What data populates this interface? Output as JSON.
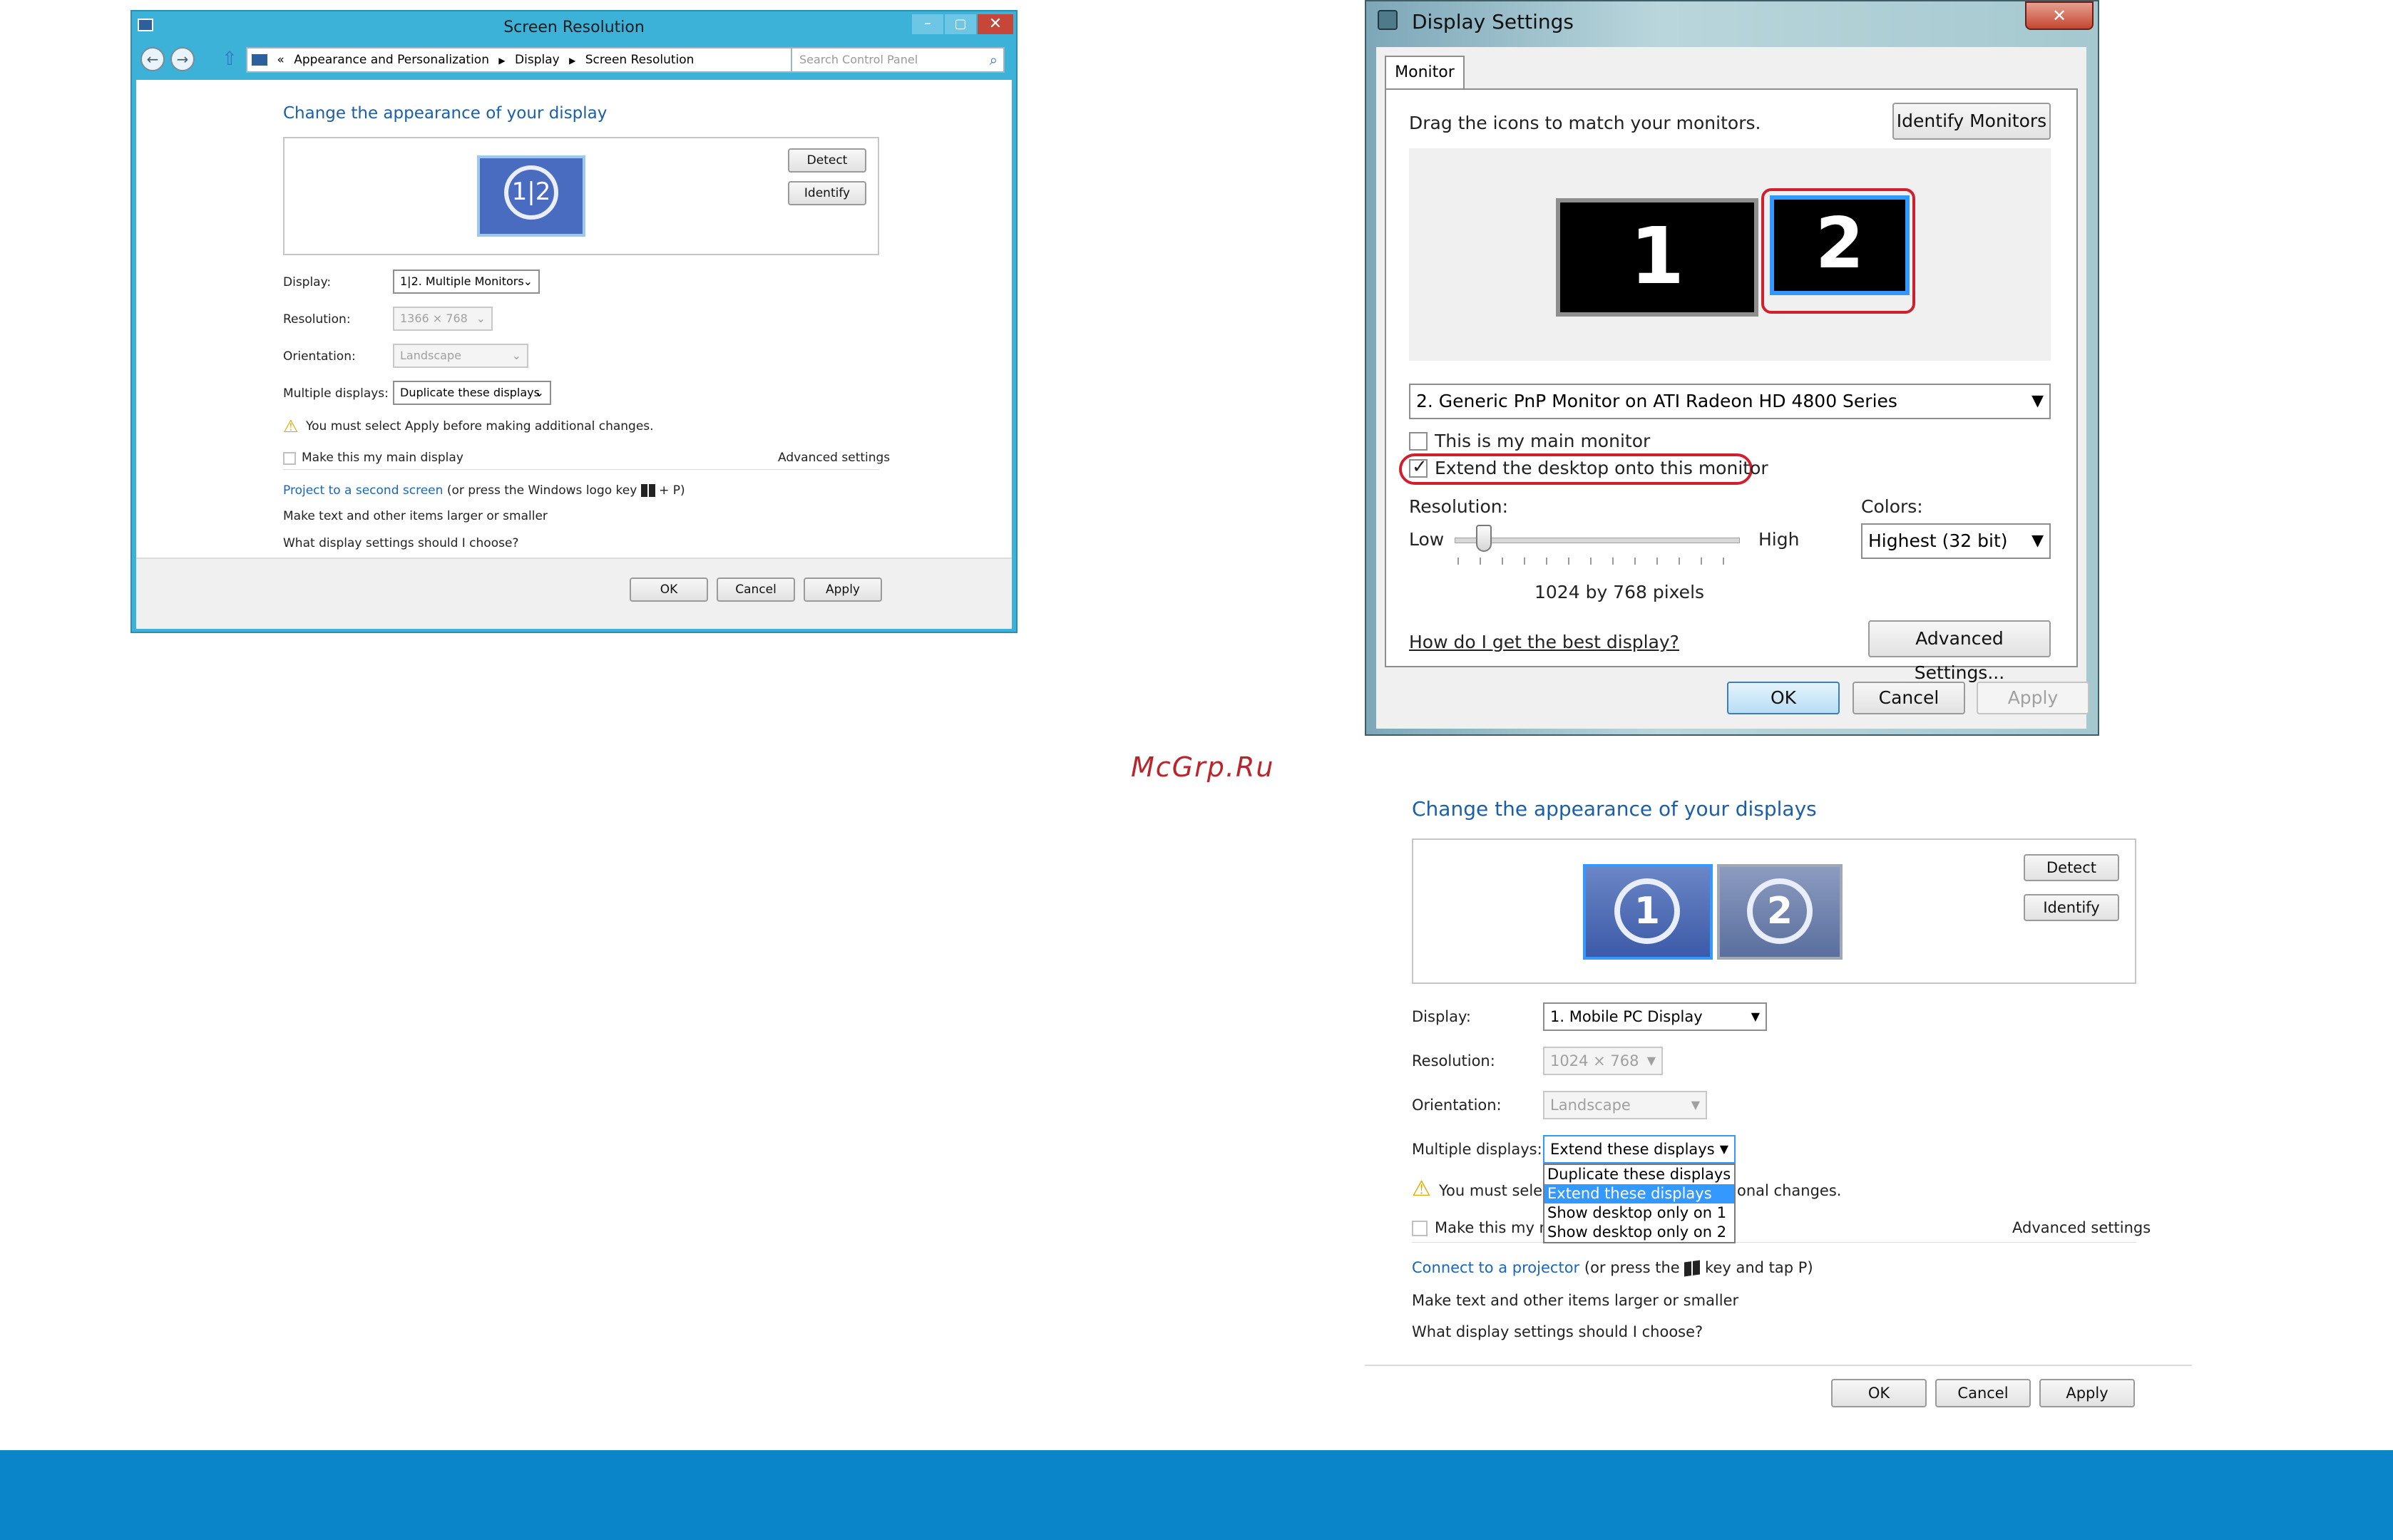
{
  "win8": {
    "title": "Screen Resolution",
    "breadcrumb": [
      "«",
      "Appearance and Personalization",
      "Display",
      "Screen Resolution"
    ],
    "search_placeholder": "Search Control Panel",
    "heading": "Change the appearance of your display",
    "monitor_label": "1|2",
    "detect": "Detect",
    "identify": "Identify",
    "display_label": "Display:",
    "display_value": "1|2. Multiple Monitors",
    "resolution_label": "Resolution:",
    "resolution_value": "1366 × 768",
    "orientation_label": "Orientation:",
    "orientation_value": "Landscape",
    "multiple_label": "Multiple displays:",
    "multiple_value": "Duplicate these displays",
    "warning": "You must select Apply before making additional changes.",
    "main_display": "Make this my main display",
    "advanced": "Advanced settings",
    "link1": "Project to a second screen",
    "link1_suffix_a": "(or press the Windows logo key",
    "link1_suffix_b": "+ P)",
    "link2": "Make text and other items larger or smaller",
    "link3": "What display settings should I choose?",
    "ok": "OK",
    "cancel": "Cancel",
    "apply": "Apply"
  },
  "vista": {
    "title": "Display Settings",
    "tab": "Monitor",
    "instruction": "Drag the icons to match your monitors.",
    "identify": "Identify Monitors",
    "monitor1": "1",
    "monitor2": "2",
    "monitor_select": "2. Generic PnP Monitor on ATI Radeon HD 4800 Series",
    "main_monitor": "This is my main monitor",
    "extend": "Extend the desktop onto this monitor",
    "resolution_label": "Resolution:",
    "low": "Low",
    "high": "High",
    "colors_label": "Colors:",
    "colors_value": "Highest (32 bit)",
    "pixels": "1024 by 768 pixels",
    "help_link": "How do I get the best display?",
    "advanced": "Advanced Settings...",
    "ok": "OK",
    "cancel": "Cancel",
    "apply": "Apply",
    "slider_position": 0.08
  },
  "watermark": "McGrp.Ru",
  "win7": {
    "heading": "Change the appearance of your displays",
    "monitor1": "1",
    "monitor2": "2",
    "detect": "Detect",
    "identify": "Identify",
    "display_label": "Display:",
    "display_value": "1. Mobile PC Display",
    "resolution_label": "Resolution:",
    "resolution_value": "1024 × 768",
    "orientation_label": "Orientation:",
    "orientation_value": "Landscape",
    "multiple_label": "Multiple displays:",
    "multiple_value": "Extend these displays",
    "options": [
      "Duplicate these displays",
      "Extend these displays",
      "Show desktop only on 1",
      "Show desktop only on 2"
    ],
    "warning_a": "You must selec",
    "warning_b": "onal changes.",
    "main_display": "Make this my ma",
    "advanced": "Advanced settings",
    "link1": "Connect to a projector",
    "link1_suffix_a": "(or press the",
    "link1_suffix_b": "key and tap P)",
    "link2": "Make text and other items larger or smaller",
    "link3": "What display settings should I choose?",
    "ok": "OK",
    "cancel": "Cancel",
    "apply": "Apply"
  },
  "colors": {
    "win8_frame": "#3cb2d8",
    "link_blue": "#1a66b8",
    "selection_blue": "#3399ff",
    "highlight_red": "#d0202e",
    "footer_bar": "#0b85c9"
  }
}
